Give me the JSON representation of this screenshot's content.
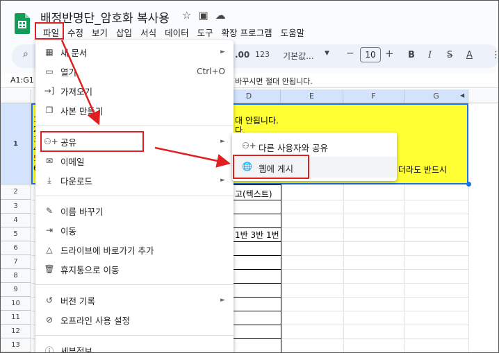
{
  "app": {
    "title": "배정반명단_암호화 복사용",
    "title_icons": [
      "star-icon",
      "folder-move-icon",
      "cloud-status-icon"
    ]
  },
  "menubar": [
    "파일",
    "수정",
    "보기",
    "삽입",
    "서식",
    "데이터",
    "도구",
    "확장 프로그램",
    "도움말"
  ],
  "toolbar": {
    "items": [
      ".00",
      "123",
      "기본값...",
      "—",
      "+",
      "B",
      "I",
      "S",
      "A"
    ],
    "font_size": "10",
    "font_name": "기본값...",
    "format_num": "123",
    "decimals": ".00"
  },
  "formula_bar": {
    "cell_ref": "A1:G1",
    "content": "바꾸시면 절대 안됩니다."
  },
  "columns": [
    "D",
    "E",
    "F",
    "G"
  ],
  "rows": [
    "1",
    "2",
    "3",
    "4",
    "5",
    "6",
    "7",
    "8",
    "9",
    "10",
    "11",
    "12",
    "13",
    "14"
  ],
  "cells": {
    "row1_left_digits": [
      "1",
      "2",
      "3",
      "4",
      "5",
      "6"
    ],
    "row1_line1": "대 안됩니다.",
    "row1_line2": "다.",
    "row1_line3": "더라도 반드시",
    "row2_d": "고(텍스트)",
    "row5_d": "1반 3반 1번"
  },
  "file_menu": {
    "items": [
      {
        "icon": "new-doc-icon",
        "label": "새 문서",
        "arrow": "►"
      },
      {
        "icon": "folder-open-icon",
        "label": "열기",
        "shortcut": "Ctrl+O"
      },
      {
        "icon": "import-icon",
        "label": "가져오기"
      },
      {
        "icon": "copy-icon",
        "label": "사본 만들기"
      },
      {
        "icon": "share-icon",
        "label": "공유",
        "arrow": "►"
      },
      {
        "icon": "email-icon",
        "label": "이메일",
        "arrow": "►"
      },
      {
        "icon": "download-icon",
        "label": "다운로드",
        "arrow": "►"
      },
      {
        "icon": "rename-icon",
        "label": "이름 바꾸기"
      },
      {
        "icon": "move-icon",
        "label": "이동"
      },
      {
        "icon": "drive-shortcut-icon",
        "label": "드라이브에 바로가기 추가"
      },
      {
        "icon": "trash-icon",
        "label": "휴지통으로 이동"
      },
      {
        "icon": "history-icon",
        "label": "버전 기록",
        "arrow": "►"
      },
      {
        "icon": "offline-icon",
        "label": "오프라인 사용 설정"
      },
      {
        "icon": "info-icon",
        "label": "세부정보"
      }
    ]
  },
  "share_submenu": {
    "items": [
      {
        "icon": "person-add-icon",
        "label": "다른 사용자와 공유"
      },
      {
        "icon": "globe-icon",
        "label": "웹에 게시"
      }
    ]
  },
  "colors": {
    "highlight_red": "#e02020",
    "sheet_yellow": "#ffff33",
    "selection_blue": "#1a73e8",
    "sheets_green": "#0f9d58"
  }
}
